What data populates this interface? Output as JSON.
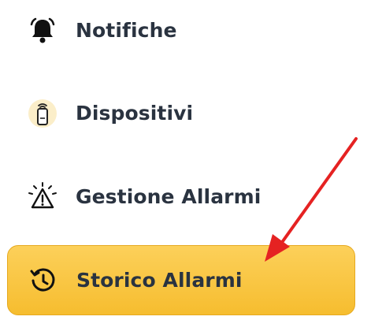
{
  "menu": {
    "items": [
      {
        "label": "Notifiche",
        "icon": "bell-icon",
        "active": false
      },
      {
        "label": "Dispositivi",
        "icon": "remote-device-icon",
        "active": false
      },
      {
        "label": "Gestione Allarmi",
        "icon": "warning-alarm-icon",
        "active": false
      },
      {
        "label": "Storico Allarmi",
        "icon": "history-icon",
        "active": true
      }
    ]
  },
  "colors": {
    "active_background": "#f8c43c",
    "label_text": "#2a3340",
    "annotation_arrow": "#e52222"
  },
  "annotation": {
    "type": "arrow",
    "points_to": "Storico Allarmi"
  }
}
